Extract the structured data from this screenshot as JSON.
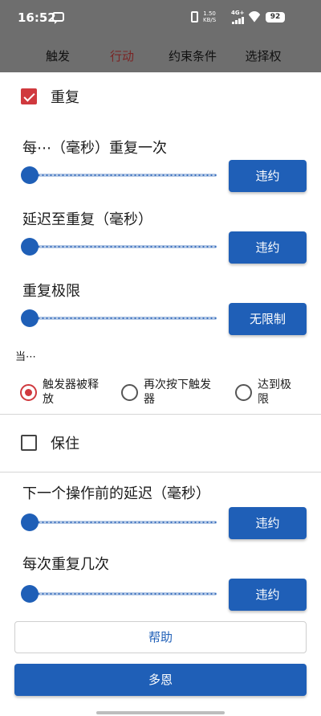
{
  "status_bar": {
    "time": "16:52",
    "net_speed_value": "1.50",
    "net_speed_unit": "KB/S",
    "signal_label": "4G+",
    "battery": "92",
    "icons": [
      "message-icon",
      "vibrate-icon",
      "signal-icon",
      "wifi-icon",
      "battery-icon"
    ]
  },
  "tabs": [
    {
      "label": "触发"
    },
    {
      "label": "行动",
      "active": true
    },
    {
      "label": "约束条件"
    },
    {
      "label": "选择权"
    }
  ],
  "colors": {
    "header_bg": "#6e6e6e",
    "accent_red": "#d0393e",
    "primary_blue": "#1f5fb7",
    "active_tab": "#7a2525"
  },
  "repeat": {
    "checkbox_label": "重复",
    "checked": true
  },
  "fields": [
    {
      "label": "每⋯（毫秒）重复一次",
      "slider_value": 0,
      "button_label": "违约"
    },
    {
      "label": "延迟至重复（毫秒）",
      "slider_value": 0,
      "button_label": "违约"
    },
    {
      "label": "重复极限",
      "slider_value": 0,
      "button_label": "无限制"
    }
  ],
  "when": {
    "label": "当⋯",
    "options": [
      {
        "line1": "触发器被释",
        "line2": "放",
        "selected": true
      },
      {
        "line1": "再次按下触发",
        "line2": "器",
        "selected": false
      },
      {
        "line1": "达到极",
        "line2": "限",
        "selected": false
      }
    ]
  },
  "hold": {
    "checkbox_label": "保住",
    "checked": false
  },
  "fields2": [
    {
      "label": "下一个操作前的延迟（毫秒）",
      "slider_value": 0,
      "button_label": "违约"
    },
    {
      "label": "每次重复几次",
      "slider_value": 0,
      "button_label": "违约"
    }
  ],
  "help_button": "帮助",
  "done_button": "多恩"
}
